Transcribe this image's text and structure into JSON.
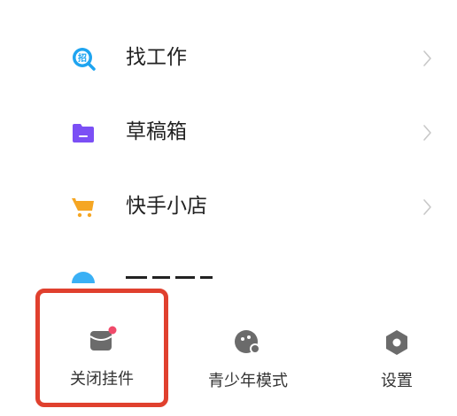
{
  "menu": {
    "items": [
      {
        "label": "找工作",
        "icon": "recruit-search-icon",
        "color": "#1ea4f0"
      },
      {
        "label": "草稿箱",
        "icon": "folder-icon",
        "color": "#7b4ff5"
      },
      {
        "label": "快手小店",
        "icon": "shopping-cart-icon",
        "color": "#f5a623"
      }
    ],
    "partial_item": {
      "icon": "partial-icon",
      "color": "#3ab0f5"
    }
  },
  "bottom_bar": {
    "tabs": [
      {
        "label": "关闭挂件",
        "icon": "widget-off-icon",
        "has_badge": true
      },
      {
        "label": "青少年模式",
        "icon": "teen-mode-icon"
      },
      {
        "label": "设置",
        "icon": "settings-icon"
      }
    ],
    "badge_color": "#f04a6a",
    "icon_color": "#6b6b6b",
    "highlight_color": "#e0402e"
  }
}
